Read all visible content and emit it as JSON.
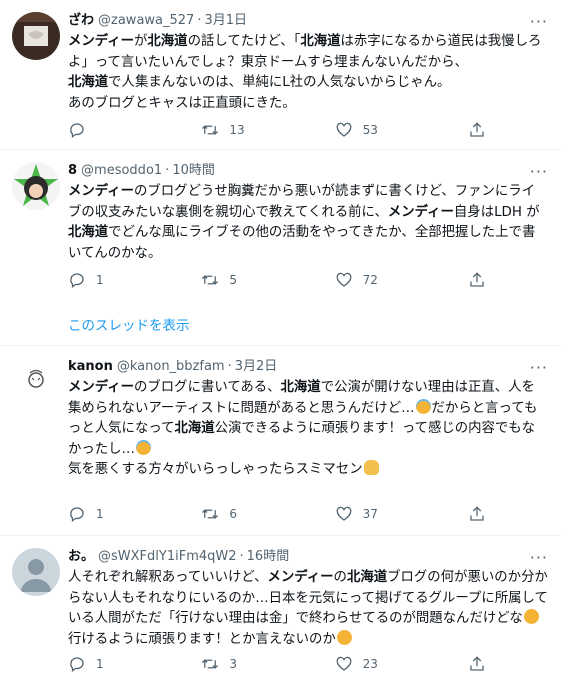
{
  "tweets": [
    {
      "name": "ざわ",
      "handle": "@zawawa_527",
      "time": "3月1日",
      "body": [
        [
          {
            "t": "メンディー",
            "b": true
          },
          {
            "t": "が"
          },
          {
            "t": "北海道",
            "b": true
          },
          {
            "t": "の話してたけど、「"
          },
          {
            "t": "北海道",
            "b": true
          },
          {
            "t": "は赤字になるから道民は我慢しろよ」って言いたいんでしょ？東京ドームすら埋まんないんだから、"
          }
        ],
        [
          {
            "t": "北海道",
            "b": true
          },
          {
            "t": "で人集まんないのは、単純にL社の人気ないからじゃん。"
          }
        ],
        [
          {
            "t": "あのブログとキャスは正直頭にきた。"
          }
        ]
      ],
      "replies": "",
      "retweets": "13",
      "likes": "53"
    },
    {
      "name": "8",
      "handle": "@mesoddo1",
      "time": "10時間",
      "body": [
        [
          {
            "t": "メンディー",
            "b": true
          },
          {
            "t": "のブログどうせ胸糞だから悪いが読まずに書くけど、ファンにライブの収支みたいな裏側を親切心で教えてくれる前に、"
          },
          {
            "t": "メンディー",
            "b": true
          },
          {
            "t": "自身はLDH が"
          },
          {
            "t": "北海道",
            "b": true
          },
          {
            "t": "でどんな風にライブその他の活動をやってきたか、全部把握した上で書いてんのかな。"
          }
        ]
      ],
      "replies": "1",
      "retweets": "5",
      "likes": "72",
      "thread_link": "このスレッドを表示"
    },
    {
      "name": "kanon",
      "handle": "@kanon_bbzfam",
      "time": "3月2日",
      "body": [
        [
          {
            "t": "メンディー",
            "b": true
          },
          {
            "t": "のブログに書いてある、"
          },
          {
            "t": "北海道",
            "b": true
          },
          {
            "t": "で公演が開けない理由は正直、人を集められないアーティストに問題があると思うんだけど…"
          },
          {
            "e": "blue"
          },
          {
            "t": "だからと言ってもっと人気になって"
          },
          {
            "t": "北海道",
            "b": true
          },
          {
            "t": "公演できるように頑張ります！って感じの内容でもなかったし…"
          },
          {
            "e": "blue"
          }
        ],
        [
          {
            "t": " "
          }
        ],
        [
          {
            "t": "気を悪くする方々がいらっしゃったらスミマセン"
          },
          {
            "e": "person"
          }
        ]
      ],
      "replies": "1",
      "retweets": "6",
      "likes": "37"
    },
    {
      "name": "お。",
      "handle": "@sWXFdlY1iFm4qW2",
      "time": "16時間",
      "body": [
        [
          {
            "t": "人それぞれ解釈あっていいけど、"
          },
          {
            "t": "メンディー",
            "b": true
          },
          {
            "t": "の"
          },
          {
            "t": "北海道",
            "b": true
          },
          {
            "t": "ブログの何が悪いのか分からない人もそれなりにいるのか…日本を元気にって掲げてるグループに所属している人間がただ「行けない理由は金」で終わらせてるのが問題なんだけどな"
          },
          {
            "e": "sweat"
          },
          {
            "t": "行けるように頑張ります！とか言えないのか"
          },
          {
            "e": "sweat"
          }
        ]
      ],
      "replies": "1",
      "retweets": "3",
      "likes": "23"
    }
  ],
  "more_label": "···"
}
